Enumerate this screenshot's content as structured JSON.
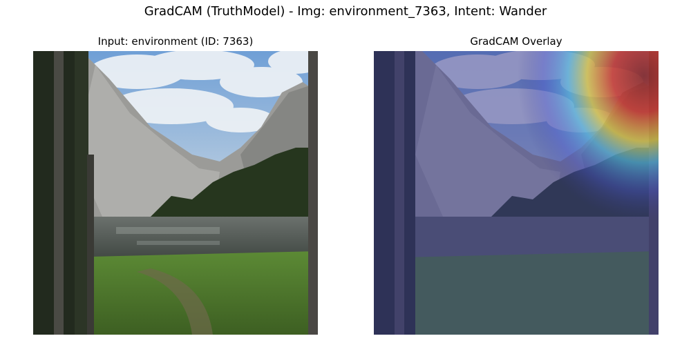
{
  "figure": {
    "title": "GradCAM (TruthModel) - Img: environment_7363, Intent: Wander"
  },
  "panels": [
    {
      "title": "Input: environment (ID: 7363)",
      "content": "landscape-photo"
    },
    {
      "title": "GradCAM Overlay",
      "content": "landscape-photo-with-heatmap"
    }
  ],
  "colors": {
    "sky": "#8fb4dc",
    "cloud": "#e9eef3",
    "mountain": "#9a9a98",
    "forest": "#27361f",
    "lake": "#5d6460",
    "meadow": "#4e7a2d",
    "overlay_tint": "#3a3a8f",
    "heat_hot": "#d23b2a",
    "heat_warm": "#e8d33a",
    "heat_cool": "#56c6e6"
  }
}
